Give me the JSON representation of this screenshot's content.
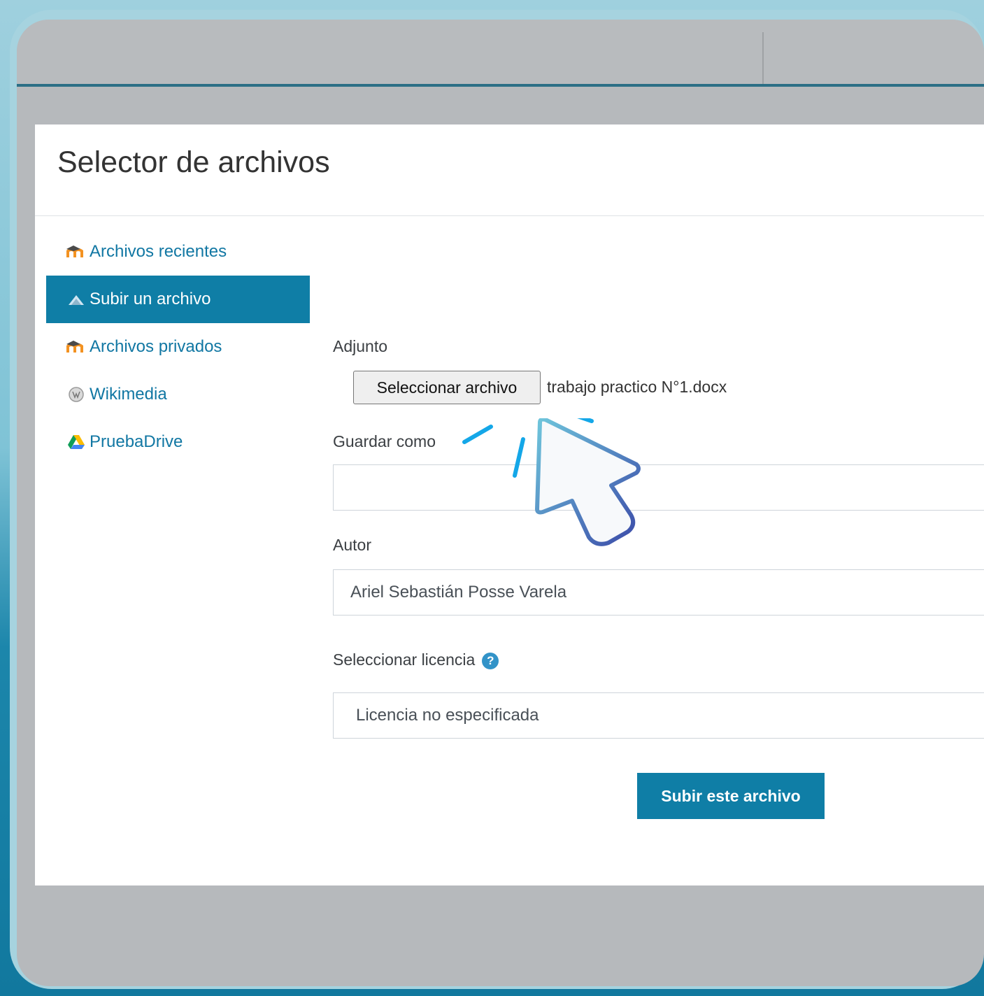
{
  "dialog": {
    "title": "Selector de archivos"
  },
  "sidebar": {
    "items": [
      {
        "label": "Archivos recientes",
        "icon": "moodle-icon",
        "active": false
      },
      {
        "label": "Subir un archivo",
        "icon": "upload-icon",
        "active": true
      },
      {
        "label": "Archivos privados",
        "icon": "moodle-icon",
        "active": false
      },
      {
        "label": "Wikimedia",
        "icon": "wikimedia-icon",
        "active": false
      },
      {
        "label": "PruebaDrive",
        "icon": "google-drive-icon",
        "active": false
      }
    ]
  },
  "form": {
    "attachment_label": "Adjunto",
    "choose_file_label": "Seleccionar archivo",
    "chosen_file": "trabajo practico N°1.docx",
    "save_as_label": "Guardar como",
    "save_as_value": "",
    "author_label": "Autor",
    "author_value": "Ariel Sebastián Posse Varela",
    "license_label": "Seleccionar licencia",
    "license_value": "Licencia no especificada",
    "submit_label": "Subir este archivo"
  },
  "colors": {
    "accent": "#0f7ea6",
    "link": "#1177a3",
    "help": "#3293c8"
  }
}
